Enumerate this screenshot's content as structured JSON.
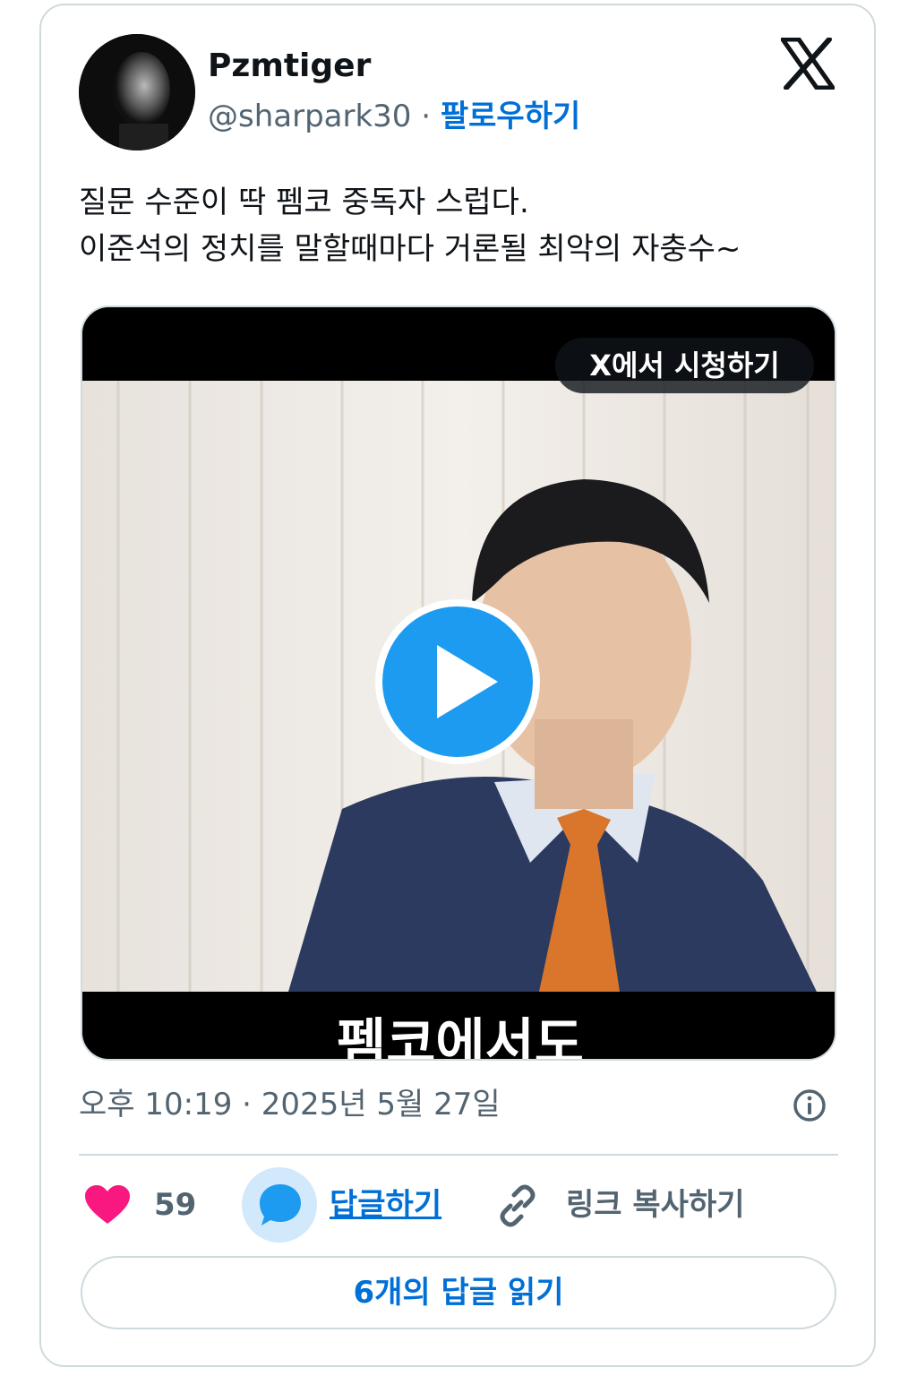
{
  "author": {
    "display_name": "Pzmtiger",
    "handle": "@sharpark30",
    "separator": " · ",
    "follow_label": "팔로우하기"
  },
  "tweet": {
    "line1": "질문 수준이 딱 펨코 중독자 스럽다.",
    "line2": "이준석의 정치를 말할때마다 거론될 최악의 자충수~"
  },
  "media": {
    "watch_label": "X에서 시청하기",
    "caption_partial": "펨코에서도"
  },
  "timestamp": "오후 10:19 · 2025년 5월 27일",
  "actions": {
    "like_count": "59",
    "reply_label": "답글하기",
    "copy_link_label": "링크 복사하기"
  },
  "read_replies_label": "6개의 답글 읽기",
  "icons": {
    "logo": "x-logo-icon",
    "like": "heart-icon",
    "reply": "speech-bubble-icon",
    "link": "link-icon",
    "info": "info-icon",
    "play": "play-icon"
  },
  "colors": {
    "accent": "#006fd6",
    "like": "#f91880",
    "secondary_text": "#536471",
    "border": "#cfd9de",
    "play": "#1d9bf0"
  }
}
